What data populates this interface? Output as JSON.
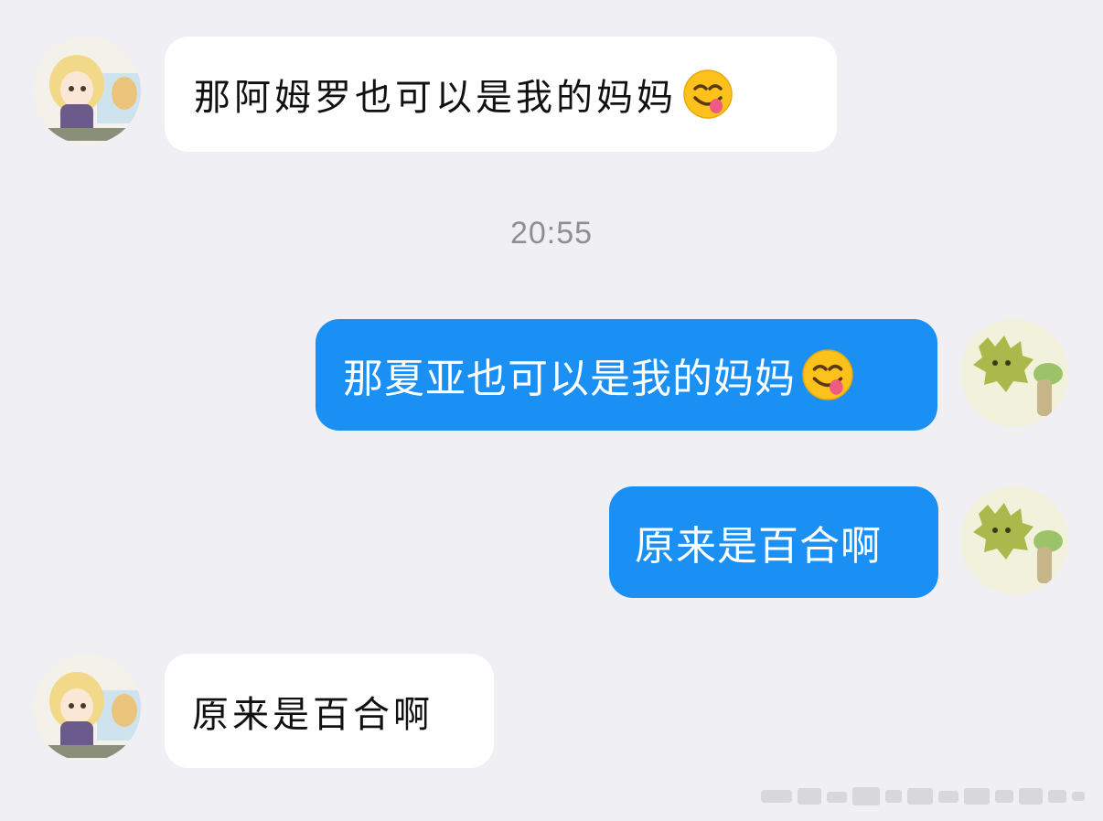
{
  "colors": {
    "background": "#efeff4",
    "received_bubble": "#ffffff",
    "sent_bubble": "#1a8ff4",
    "sent_text": "#ffffff",
    "timestamp_text": "#8e8e93"
  },
  "messages": [
    {
      "direction": "received",
      "text": "那阿姆罗也可以是我的妈妈",
      "emoji": "yum-face-emoji",
      "avatar": "blonde-anime-girl-avatar"
    },
    {
      "direction": "sent",
      "text": "那夏亚也可以是我的妈妈",
      "emoji": "yum-face-emoji",
      "avatar": "green-sprite-avatar"
    },
    {
      "direction": "sent",
      "text": "原来是百合啊",
      "avatar": "green-sprite-avatar"
    },
    {
      "direction": "received",
      "text": "原来是百合啊",
      "avatar": "blonde-anime-girl-avatar"
    }
  ],
  "timestamp": "20:55"
}
